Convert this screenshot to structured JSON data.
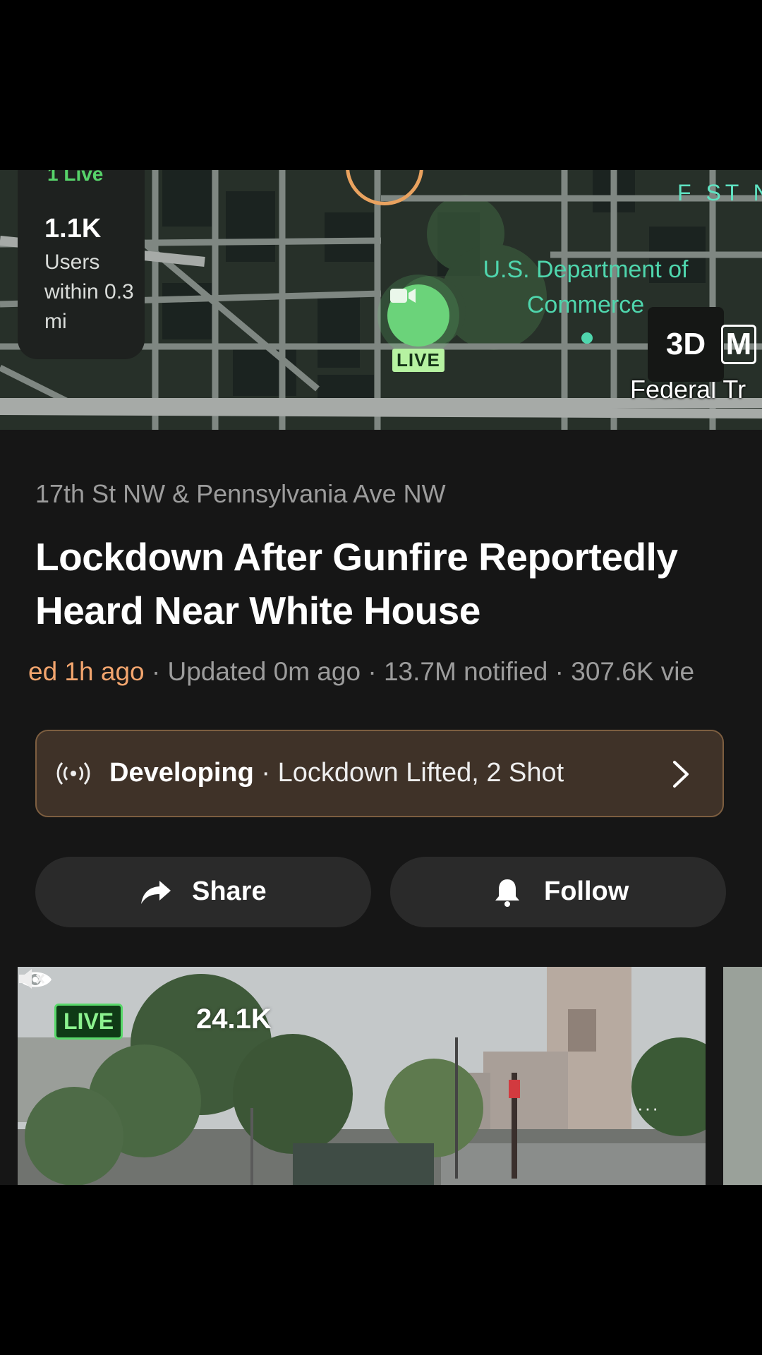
{
  "map": {
    "live_count_label": "1 Live",
    "users_count": "1.1K",
    "users_label": "Users within 0.3 mi",
    "pin_live_label": "LIVE",
    "place_label": "U.S. Department of Commerce",
    "street_top": "F ST N",
    "street_bottom": "Federal Tr",
    "btn_3d": "3D",
    "btn_m": "M",
    "colors": {
      "live_green": "#6bd37a",
      "place_teal": "#4fd6ad"
    }
  },
  "story": {
    "address": "17th St NW & Pennsylvania Ave NW",
    "headline": "Lockdown After Gunfire Reportedly Heard Near White House",
    "meta_started": "ed 1h ago",
    "meta_rest": " · Updated 0m ago · 13.7M notified · 307.6K vie"
  },
  "developing": {
    "icon": "broadcast-icon",
    "label": "Developing",
    "text": " · Lockdown Lifted, 2 Shot"
  },
  "actions": {
    "share_label": "Share",
    "follow_label": "Follow"
  },
  "video": {
    "live_label": "LIVE",
    "views": "24.1K",
    "more_label": "···"
  }
}
